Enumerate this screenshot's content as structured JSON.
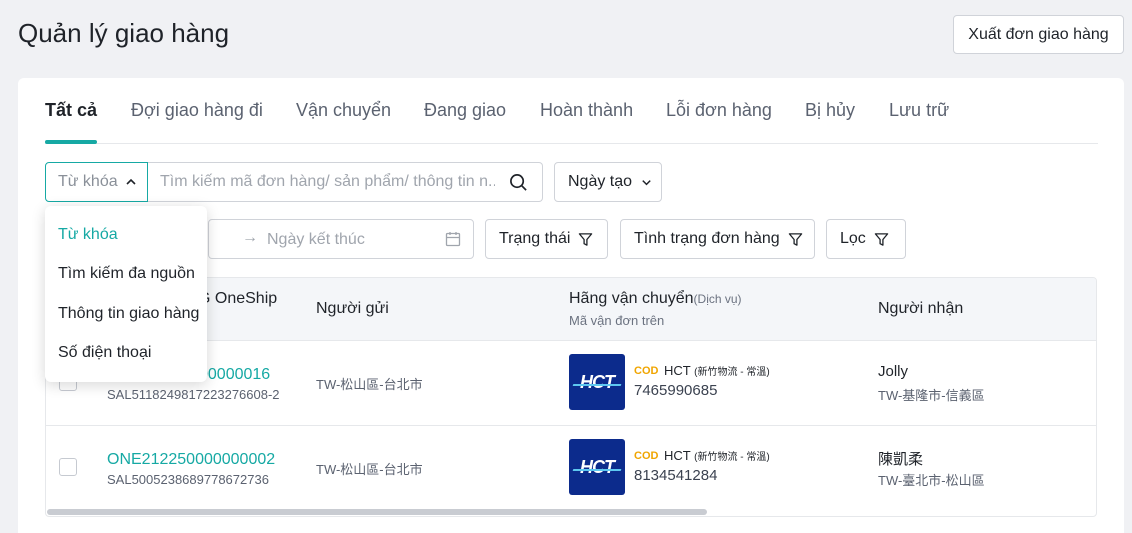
{
  "header": {
    "title": "Quản lý giao hàng",
    "export_label": "Xuất đơn giao hàng"
  },
  "tabs": [
    {
      "label": "Tất cả",
      "active": true
    },
    {
      "label": "Đợi giao hàng đi"
    },
    {
      "label": "Vận chuyển"
    },
    {
      "label": "Đang giao"
    },
    {
      "label": "Hoàn thành"
    },
    {
      "label": "Lỗi đơn hàng"
    },
    {
      "label": "Bị hủy"
    },
    {
      "label": "Lưu trữ"
    }
  ],
  "filters": {
    "keyword_select": "Từ khóa",
    "search_placeholder": "Tìm kiếm mã đơn hàng/ sản phẩm/ thông tin n...",
    "date_select": "Ngày tạo",
    "end_date_placeholder": "Ngày kết thúc",
    "status_label": "Trạng thái",
    "order_state_label": "Tình trạng đơn hàng",
    "filter_label": "Lọc"
  },
  "dropdown": {
    "items": [
      {
        "label": "Từ khóa",
        "selected": true
      },
      {
        "label": "Tìm kiếm đa nguồn"
      },
      {
        "label": "Thông tin giao hàng"
      },
      {
        "label": "Số điện thoại"
      }
    ]
  },
  "table": {
    "columns": {
      "order_partial": "G OneShip",
      "sender": "Người gửi",
      "carrier": "Hãng vận chuyển",
      "carrier_paren": "(Dịch vụ)",
      "carrier_sub": "Mã vận đơn trên",
      "receiver": "Người nhận"
    },
    "rows": [
      {
        "order_id": "00000016",
        "order_sub": "SAL5118249817223276608-2",
        "sender": "TW-松山區-台北市",
        "cod": "COD",
        "carrier": "HCT",
        "service": "(新竹物流 - 常溫)",
        "tracking": "7465990685",
        "receiver_name": "Jolly",
        "receiver_addr": "TW-基隆市-信義區",
        "logo_text": "HCT"
      },
      {
        "order_id": "ONE212250000000002",
        "order_sub": "SAL5005238689778672736",
        "sender": "TW-松山區-台北市",
        "cod": "COD",
        "carrier": "HCT",
        "service": "(新竹物流 - 常溫)",
        "tracking": "8134541284",
        "receiver_name": "陳凱柔",
        "receiver_addr": "TW-臺北市-松山區",
        "logo_text": "HCT"
      }
    ]
  },
  "colors": {
    "accent": "#16a9a4",
    "cod": "#f0a500",
    "hct_logo": "#0c2b8c"
  }
}
